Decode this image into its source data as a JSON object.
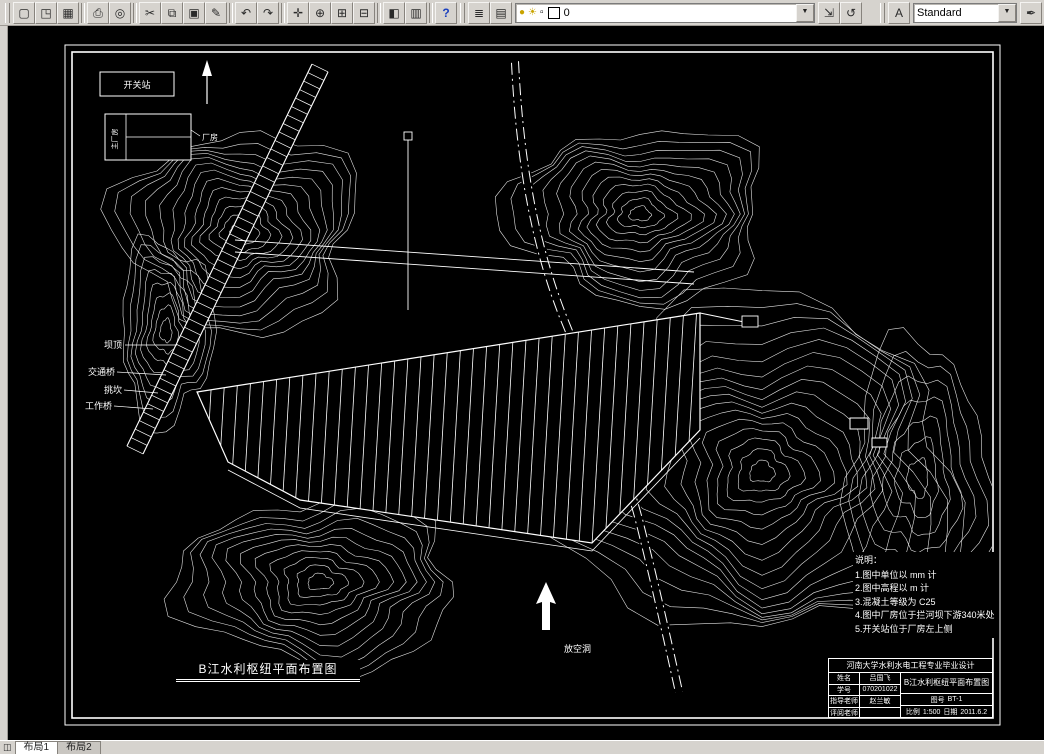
{
  "colors": {
    "toolbar_bg": "#d6d3ce",
    "canvas_bg": "#000000",
    "line": "#ffffff"
  },
  "toolbar": {
    "icons": [
      {
        "name": "new-icon",
        "glyph": "▢"
      },
      {
        "name": "open-icon",
        "glyph": "◳"
      },
      {
        "name": "save-icon",
        "glyph": "▦"
      },
      {
        "name": "plot-icon",
        "glyph": "⎙"
      },
      {
        "name": "plot-preview-icon",
        "glyph": "◎"
      },
      {
        "name": "cut-icon",
        "glyph": "✂"
      },
      {
        "name": "copy-icon",
        "glyph": "⧉"
      },
      {
        "name": "paste-icon",
        "glyph": "▣"
      },
      {
        "name": "match-properties-icon",
        "glyph": "✎"
      },
      {
        "name": "undo-icon",
        "glyph": "↶"
      },
      {
        "name": "redo-icon",
        "glyph": "↷"
      },
      {
        "name": "pan-icon",
        "glyph": "✛"
      },
      {
        "name": "zoom-realtime-icon",
        "glyph": "⊕"
      },
      {
        "name": "zoom-window-icon",
        "glyph": "⊞"
      },
      {
        "name": "zoom-previous-icon",
        "glyph": "⊟"
      },
      {
        "name": "properties-icon",
        "glyph": "◧"
      },
      {
        "name": "designcenter-icon",
        "glyph": "▥"
      },
      {
        "name": "help-icon",
        "glyph": "?"
      },
      {
        "name": "layers-icon",
        "glyph": "≣"
      },
      {
        "name": "layer-states-icon",
        "glyph": "▤"
      },
      {
        "name": "make-layer-current-icon",
        "glyph": "⇲"
      },
      {
        "name": "layer-previous-icon",
        "glyph": "↺"
      },
      {
        "name": "text-style-icon",
        "glyph": "A"
      },
      {
        "name": "pen-icon",
        "glyph": "✒"
      }
    ],
    "dropdown_icon": "▼",
    "layer_combo": {
      "value": "0",
      "on_icon": "●",
      "freeze_icon": "☀",
      "lock_icon": "▫"
    },
    "style_combo": {
      "value": "Standard"
    }
  },
  "statusbar": {
    "tabs_icon": "◫",
    "tabs": [
      {
        "label": "布局1"
      },
      {
        "label": "布局2"
      }
    ]
  },
  "drawing": {
    "legend": {
      "switch_station": "开关站",
      "main_plant": "主厂房",
      "plant_callout": "厂房"
    },
    "labels": {
      "dam_crest": "坝顶",
      "traffic_bridge": "交通桥",
      "flip_bucket": "挑坎",
      "work_bridge": "工作桥",
      "emptying_tunnel": "放空洞"
    },
    "title": "B江水利枢纽平面布置图",
    "notes": {
      "heading": "说明：",
      "items": [
        "1.图中单位以 mm 计",
        "2.图中高程以 m 计",
        "3.混凝土等级为 C25",
        "4.图中厂房位于拦河坝下游340米处",
        "5.开关站位于厂房左上侧"
      ]
    },
    "title_block": {
      "header": "河南大学水利水电工程专业毕业设计",
      "name_label": "姓名",
      "name_value": "吕国飞",
      "id_label": "学号",
      "id_value": "070201022",
      "advisor_label": "指导老师",
      "advisor_value": "赵兰敏",
      "reviewer_label": "评阅老师",
      "reviewer_value": "",
      "drawing_name": "B江水利枢纽平面布置图",
      "no_label": "图号",
      "no_value": "BT-1",
      "scale_label": "比例",
      "scale_value": "1:500",
      "date_label": "日期",
      "date_value": "2011.6.2"
    }
  }
}
